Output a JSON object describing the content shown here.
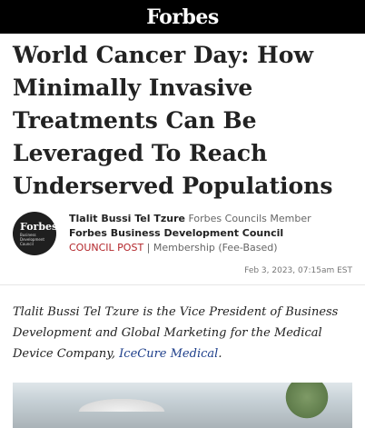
{
  "header": {
    "brand": "Forbes"
  },
  "article": {
    "headline": "World Cancer Day: How Minimally Invasive Treatments Can Be Leveraged To Reach Underserved Populations",
    "author": {
      "avatar_top": "Forbes",
      "avatar_sub_lines": [
        "Business",
        "Development",
        "Council"
      ],
      "name": "Tlalit Bussi Tel Tzure",
      "role": "Forbes Councils Member",
      "council": "Forbes Business Development Council",
      "post_type": "COUNCIL POST",
      "separator": "|",
      "membership": "Membership (Fee-Based)"
    },
    "date": "Feb 3, 2023, 07:15am EST",
    "intro_before": "Tlalit Bussi Tel Tzure is the Vice President of Business Development and Global Marketing for the Medical Device Company, ",
    "intro_link": "IceCure Medical",
    "intro_after": "."
  },
  "colors": {
    "topbar": "#000000",
    "post_type": "#b3262b",
    "link": "#1d3e8a"
  }
}
